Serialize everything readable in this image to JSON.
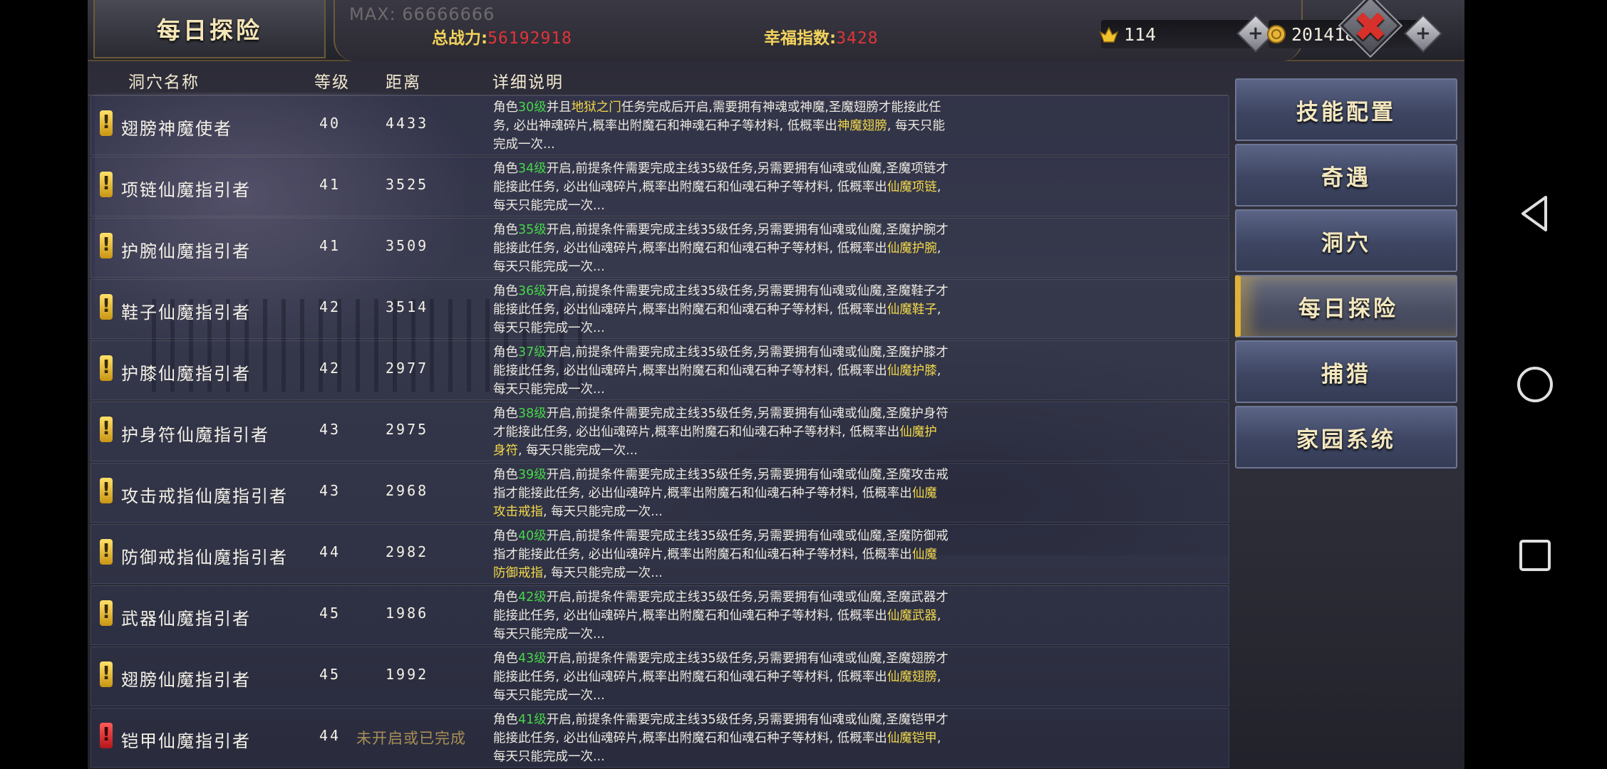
{
  "header": {
    "title": "每日探险",
    "max_text": "MAX: 66666666",
    "power_label": "总战力:",
    "power_value": "56192918",
    "happiness_label": "幸福指数:",
    "happiness_value": "3428",
    "ingot_value": "114",
    "coin_value": "2014185",
    "plus_symbol": "+",
    "close_symbol": "✖"
  },
  "table": {
    "headers": {
      "name": "洞穴名称",
      "level": "等级",
      "distance": "距离",
      "description": "详细说明"
    },
    "rows": [
      {
        "name": "翅膀神魔使者",
        "level": "40",
        "distance": "4433",
        "status": "yellow",
        "d1": "角色",
        "dlv": "30级",
        "d2": "并且",
        "dcond": "地狱之门",
        "d3": "任务完成后开启,需要拥有神魂或神魔,圣魔翅膀才能接此任务, 必出神魂碎片,概率出附魔石和神魂石种子等材料, 低概率出",
        "ditem": "神魔翅膀",
        "d4": ", 每天只能完成一次..."
      },
      {
        "name": "项链仙魔指引者",
        "level": "41",
        "distance": "3525",
        "status": "yellow",
        "d1": "角色",
        "dlv": "34级",
        "d2": "",
        "dcond": "",
        "d3": "开启,前提条件需要完成主线35级任务,另需要拥有仙魂或仙魔,圣魔项链才能接此任务, 必出仙魂碎片,概率出附魔石和仙魂石种子等材料, 低概率出",
        "ditem": "仙魔项链",
        "d4": ", 每天只能完成一次..."
      },
      {
        "name": "护腕仙魔指引者",
        "level": "41",
        "distance": "3509",
        "status": "yellow",
        "d1": "角色",
        "dlv": "35级",
        "d2": "",
        "dcond": "",
        "d3": "开启,前提条件需要完成主线35级任务,另需要拥有仙魂或仙魔,圣魔护腕才能接此任务, 必出仙魂碎片,概率出附魔石和仙魂石种子等材料, 低概率出",
        "ditem": "仙魔护腕",
        "d4": ", 每天只能完成一次..."
      },
      {
        "name": "鞋子仙魔指引者",
        "level": "42",
        "distance": "3514",
        "status": "yellow",
        "d1": "角色",
        "dlv": "36级",
        "d2": "",
        "dcond": "",
        "d3": "开启,前提条件需要完成主线35级任务,另需要拥有仙魂或仙魔,圣魔鞋子才能接此任务, 必出仙魂碎片,概率出附魔石和仙魂石种子等材料, 低概率出",
        "ditem": "仙魔鞋子",
        "d4": ", 每天只能完成一次..."
      },
      {
        "name": "护膝仙魔指引者",
        "level": "42",
        "distance": "2977",
        "status": "yellow",
        "d1": "角色",
        "dlv": "37级",
        "d2": "",
        "dcond": "",
        "d3": "开启,前提条件需要完成主线35级任务,另需要拥有仙魂或仙魔,圣魔护膝才能接此任务, 必出仙魂碎片,概率出附魔石和仙魂石种子等材料, 低概率出",
        "ditem": "仙魔护膝",
        "d4": ", 每天只能完成一次..."
      },
      {
        "name": "护身符仙魔指引者",
        "level": "43",
        "distance": "2975",
        "status": "yellow",
        "d1": "角色",
        "dlv": "38级",
        "d2": "",
        "dcond": "",
        "d3": "开启,前提条件需要完成主线35级任务,另需要拥有仙魂或仙魔,圣魔护身符才能接此任务, 必出仙魂碎片,概率出附魔石和仙魂石种子等材料, 低概率出",
        "ditem": "仙魔护身符",
        "d4": ", 每天只能完成一次..."
      },
      {
        "name": "攻击戒指仙魔指引者",
        "level": "43",
        "distance": "2968",
        "status": "yellow",
        "d1": "角色",
        "dlv": "39级",
        "d2": "",
        "dcond": "",
        "d3": "开启,前提条件需要完成主线35级任务,另需要拥有仙魂或仙魔,圣魔攻击戒指才能接此任务, 必出仙魂碎片,概率出附魔石和仙魂石种子等材料, 低概率出",
        "ditem": "仙魔攻击戒指",
        "d4": ", 每天只能完成一次..."
      },
      {
        "name": "防御戒指仙魔指引者",
        "level": "44",
        "distance": "2982",
        "status": "yellow",
        "d1": "角色",
        "dlv": "40级",
        "d2": "",
        "dcond": "",
        "d3": "开启,前提条件需要完成主线35级任务,另需要拥有仙魂或仙魔,圣魔防御戒指才能接此任务, 必出仙魂碎片,概率出附魔石和仙魂石种子等材料, 低概率出",
        "ditem": "仙魔防御戒指",
        "d4": ", 每天只能完成一次..."
      },
      {
        "name": "武器仙魔指引者",
        "level": "45",
        "distance": "1986",
        "status": "yellow",
        "d1": "角色",
        "dlv": "42级",
        "d2": "",
        "dcond": "",
        "d3": "开启,前提条件需要完成主线35级任务,另需要拥有仙魂或仙魔,圣魔武器才能接此任务, 必出仙魂碎片,概率出附魔石和仙魂石种子等材料, 低概率出",
        "ditem": "仙魔武器",
        "d4": ", 每天只能完成一次..."
      },
      {
        "name": "翅膀仙魔指引者",
        "level": "45",
        "distance": "1992",
        "status": "yellow",
        "d1": "角色",
        "dlv": "43级",
        "d2": "",
        "dcond": "",
        "d3": "开启,前提条件需要完成主线35级任务,另需要拥有仙魂或仙魔,圣魔翅膀才能接此任务, 必出仙魂碎片,概率出附魔石和仙魂石种子等材料, 低概率出",
        "ditem": "仙魔翅膀",
        "d4": ", 每天只能完成一次..."
      },
      {
        "name": "铠甲仙魔指引者",
        "level": "44",
        "distance": "未开启或已完成",
        "status": "red",
        "d1": "角色",
        "dlv": "41级",
        "d2": "",
        "dcond": "",
        "d3": "开启,前提条件需要完成主线35级任务,另需要拥有仙魂或仙魔,圣魔铠甲才能接此任务, 必出仙魂碎片,概率出附魔石和仙魂石种子等材料, 低概率出",
        "ditem": "仙魔铠甲",
        "d4": ", 每天只能完成一次..."
      }
    ]
  },
  "side_menu": {
    "items": [
      {
        "label": "技能配置",
        "active": false
      },
      {
        "label": "奇遇",
        "active": false
      },
      {
        "label": "洞穴",
        "active": false
      },
      {
        "label": "每日探险",
        "active": true
      },
      {
        "label": "捕猎",
        "active": false
      },
      {
        "label": "家园系统",
        "active": false
      }
    ]
  },
  "colors": {
    "accent_gold": "#f3d35b",
    "value_red": "#e0343a",
    "level_green": "#47d64a",
    "item_yellow": "#f2d84a"
  }
}
